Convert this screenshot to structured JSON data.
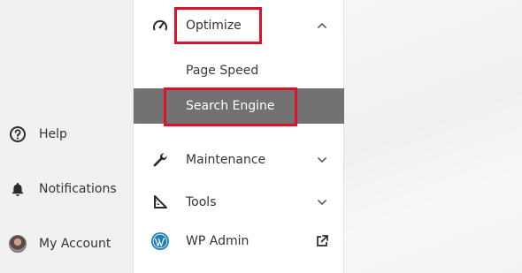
{
  "left_nav": {
    "items": [
      {
        "label": "Help",
        "icon": "help-circle-icon"
      },
      {
        "label": "Notifications",
        "icon": "bell-icon"
      },
      {
        "label": "My Account",
        "icon": "avatar"
      }
    ]
  },
  "menu": {
    "optimize": {
      "label": "Optimize",
      "icon": "gauge-icon",
      "expanded": true
    },
    "submenu": [
      {
        "label": "Page Speed",
        "active": false
      },
      {
        "label": "Search Engine",
        "active": true
      }
    ],
    "maintenance": {
      "label": "Maintenance",
      "icon": "wrench-icon"
    },
    "tools": {
      "label": "Tools",
      "icon": "set-square-icon"
    },
    "wp_admin": {
      "label": "WP Admin",
      "icon": "wordpress-icon",
      "action_icon": "external-link-icon"
    }
  },
  "colors": {
    "active_bg": "#737171",
    "highlight": "#e0102d",
    "wordpress": "#1f7fb5"
  }
}
